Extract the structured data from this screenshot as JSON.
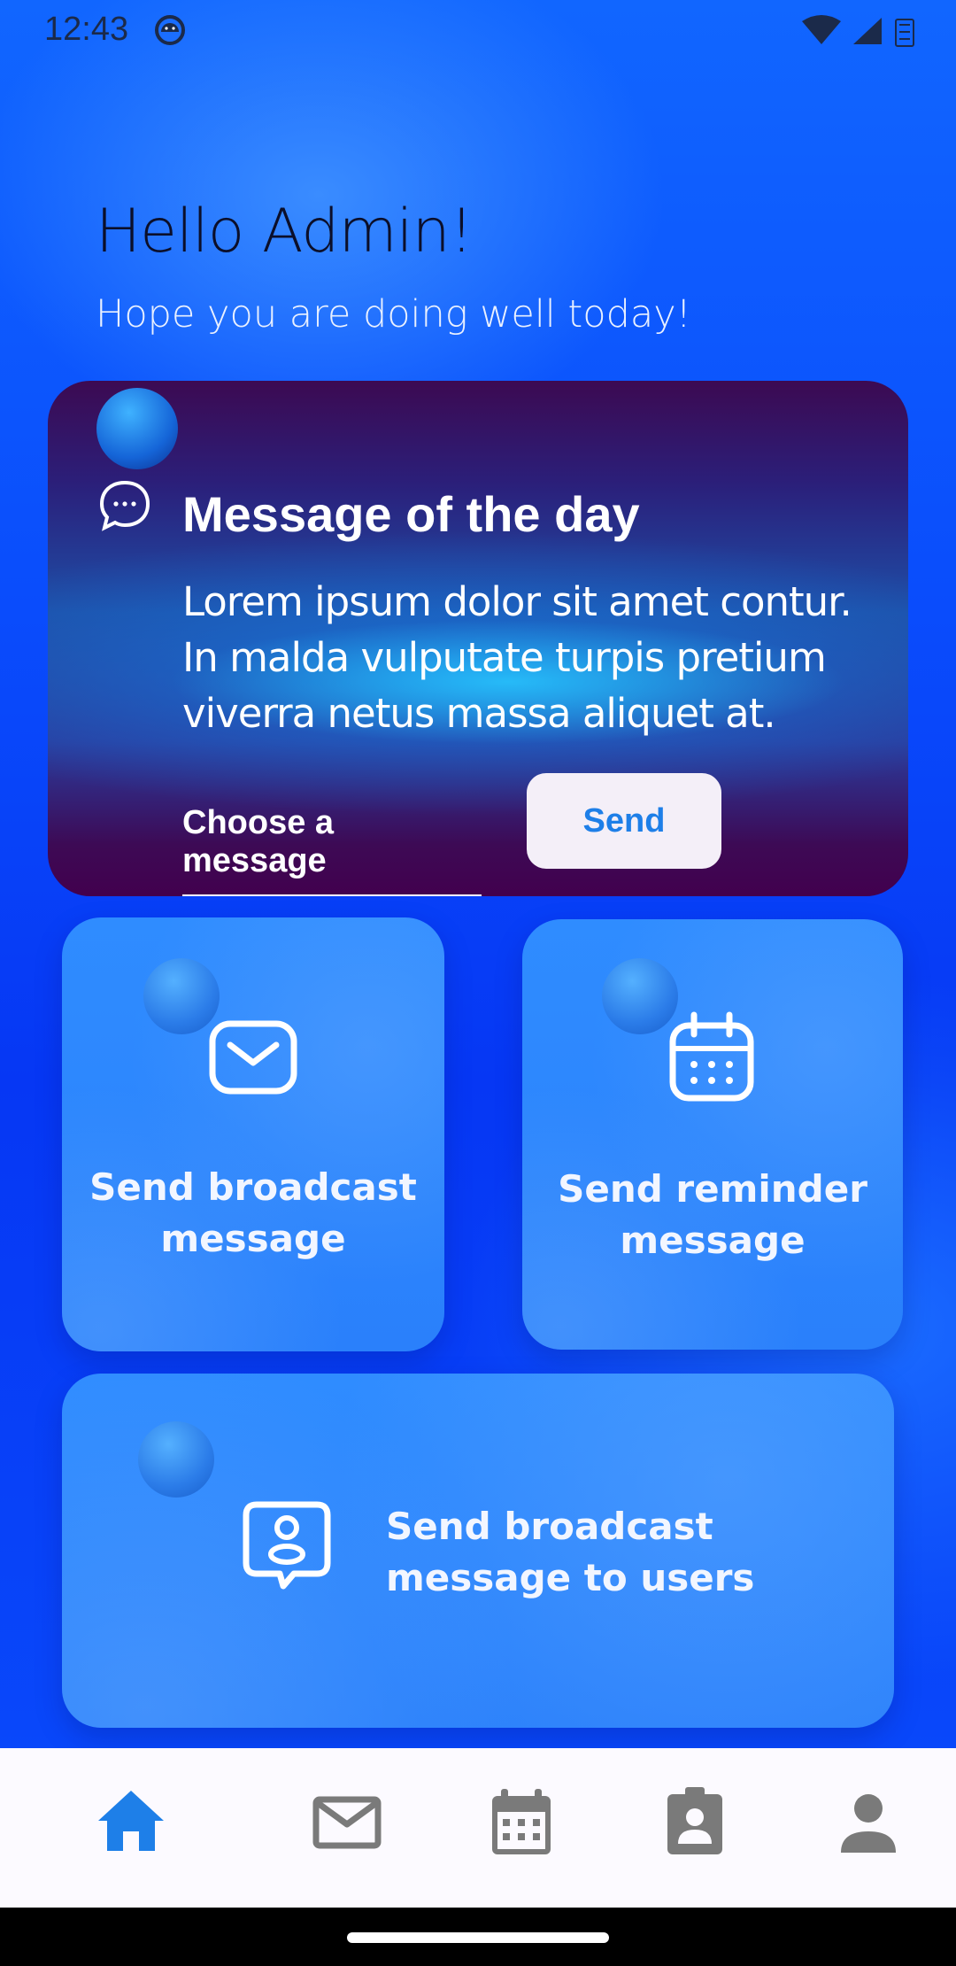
{
  "status_bar": {
    "time": "12:43"
  },
  "greeting": {
    "title": "Hello Admin!",
    "subtitle": "Hope you are doing well today!"
  },
  "motd": {
    "title": "Message of the day",
    "body": "Lorem ipsum dolor sit amet contur. In malda vulputate turpis pretium viverra netus massa aliquet at.",
    "choose_label": "Choose a message",
    "send_label": "Send"
  },
  "tiles": [
    {
      "label_line1": "Send broadcast",
      "label_line2": "message",
      "icon": "envelope-icon"
    },
    {
      "label_line1": "Send reminder",
      "label_line2": "message",
      "icon": "calendar-icon"
    },
    {
      "label_line1": "Send broadcast",
      "label_line2": "message to users",
      "icon": "user-badge-icon"
    }
  ],
  "bottom_nav": {
    "items": [
      {
        "icon": "home-icon",
        "active": true
      },
      {
        "icon": "mail-icon",
        "active": false
      },
      {
        "icon": "calendar-icon",
        "active": false
      },
      {
        "icon": "contact-icon",
        "active": false
      },
      {
        "icon": "person-icon",
        "active": false
      }
    ]
  },
  "colors": {
    "accent": "#1e7fe8",
    "inactive": "#7a7a7a",
    "card_bg": "#42004e"
  }
}
